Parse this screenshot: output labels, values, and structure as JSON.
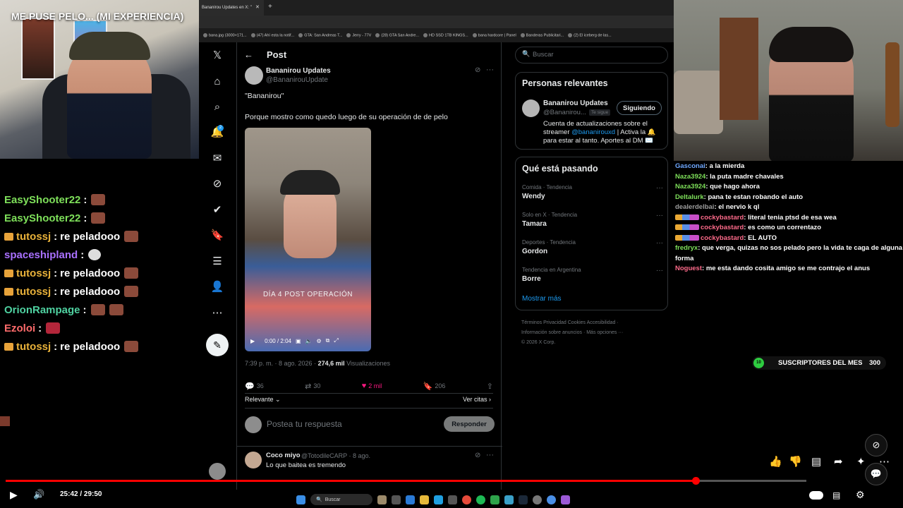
{
  "stream_title": "ME PUSE PELO... (MI EXPERIENCIA)",
  "browser": {
    "active_tab": "Bananirou Updates en X: \"",
    "tab_close": "✕",
    "new_tab": "+",
    "bookmarks": [
      "bana.jpg (3000×171...",
      "(47) Ahí esta la notif...",
      "GTA: San Andreas T...",
      "Jerry - 77V",
      "(28) GTA San Andre...",
      "HD SSD 1TB KINGS...",
      "bana hardcore | Panel",
      "Banderas Publicitari...",
      "(2) El iceberg de las..."
    ]
  },
  "chat_left": [
    {
      "user": "EasyShooter22",
      "color": "#7ee05a",
      "msg": "",
      "badge": false,
      "emote": "brown"
    },
    {
      "user": "EasyShooter22",
      "color": "#7ee05a",
      "msg": "",
      "badge": false,
      "emote": "brown"
    },
    {
      "user": "tutossj",
      "color": "#e8b13a",
      "msg": "re peladooo",
      "badge": true,
      "emote": "brown"
    },
    {
      "user": "spaceshipland",
      "color": "#a970ff",
      "msg": "",
      "badge": false,
      "emote": "white"
    },
    {
      "user": "tutossj",
      "color": "#e8b13a",
      "msg": "re peladooo",
      "badge": true,
      "emote": "brown"
    },
    {
      "user": "tutossj",
      "color": "#e8b13a",
      "msg": "re peladooo",
      "badge": true,
      "emote": "brown"
    },
    {
      "user": "OrionRampage",
      "color": "#4fd2a1",
      "msg": "",
      "badge": false,
      "emote": "double"
    },
    {
      "user": "Ezoloi",
      "color": "#ff6b6b",
      "msg": "",
      "badge": false,
      "emote": "red"
    },
    {
      "user": "tutossj",
      "color": "#e8b13a",
      "msg": "re peladooo",
      "badge": true,
      "emote": "brown"
    }
  ],
  "x": {
    "nav_icons": [
      "x-logo-icon",
      "home-icon",
      "search-icon",
      "notifications-icon",
      "messages-icon",
      "grok-icon",
      "communities-icon",
      "bookmarks-icon",
      "lists-icon",
      "profile-icon",
      "more-icon"
    ],
    "notif_count": "2",
    "header_title": "Post",
    "back": "←",
    "author_name": "Bananirou Updates",
    "author_handle": "@BananirouUpdate",
    "tweet_line1": "\"Bananirou\"",
    "tweet_line2": "Porque mostro como quedo luego de su operación de de pelo",
    "video_overlay": "DÍA 4 POST OPERACIÓN",
    "video_time": "0:00 / 2:04",
    "meta_time": "7:39 p. m. · 8 ago. 2026 · ",
    "meta_views": "274,6 mil",
    "meta_views_label": " Visualizaciones",
    "replies": "36",
    "reposts": "30",
    "likes": "2 mil",
    "bookmarks": "206",
    "sort_label": "Relevante",
    "quotes_label": "Ver citas",
    "reply_placeholder": "Postea tu respuesta",
    "reply_button": "Responder",
    "comment_name": "Coco miyo",
    "comment_handle": "@TotodileCARP · 8 ago.",
    "comment_text": "Lo que baitea es tremendo",
    "search_placeholder": "Buscar",
    "relevant_title": "Personas relevantes",
    "rel_name": "Bananirou Updates",
    "rel_handle": "@Bananirou...",
    "rel_follows_you": "Te sigue",
    "rel_button": "Siguiendo",
    "rel_bio1": "Cuenta de actualizaciones sobre el",
    "rel_bio2_a": "streamer ",
    "rel_bio2_link": "@bananirouxd",
    "rel_bio2_b": " | Activa la 🔔",
    "rel_bio3": "para estar al tanto. Aportes al DM ✉️",
    "trends_title": "Qué está pasando",
    "trends": [
      {
        "context": "Comida · Tendencia",
        "name": "Wendy"
      },
      {
        "context": "Solo en X · Tendencia",
        "name": "Tamara"
      },
      {
        "context": "Deportes · Tendencia",
        "name": "Gordon"
      },
      {
        "context": "Tendencia en Argentina",
        "name": "Borre"
      }
    ],
    "show_more": "Mostrar más",
    "footer1": "Términos     Privacidad     Cookies     Accesibilidad  ·",
    "footer2": "Información sobre anuncios  ·   Más opciones  ···",
    "footer3": "© 2026 X Corp."
  },
  "chat_right": [
    {
      "user": "Gasconai",
      "color": "#6fa8ff",
      "msg": "a la mierda",
      "badges": false
    },
    {
      "user": "Naza3924",
      "color": "#7ee05a",
      "msg": "la puta madre chavales",
      "badges": false
    },
    {
      "user": "Naza3924",
      "color": "#7ee05a",
      "msg": "que hago ahora",
      "badges": false
    },
    {
      "user": "Deltalurk",
      "color": "#7ee05a",
      "msg": "pana te estan robando el auto",
      "badges": false
    },
    {
      "user": "dealerdelbai",
      "color": "#9e9e9e",
      "msg": "el nervio k ql",
      "badges": false
    },
    {
      "user": "cockybastard",
      "color": "#ff6b8b",
      "msg": "literal tenia ptsd de esa wea",
      "badges": true
    },
    {
      "user": "cockybastard",
      "color": "#ff6b8b",
      "msg": "es como un correntazo",
      "badges": true
    },
    {
      "user": "cockybastard",
      "color": "#ff6b8b",
      "msg": "EL AUTO",
      "badges": true
    },
    {
      "user": "fredryx",
      "color": "#7ee05a",
      "msg": "que verga, quizas no sos pelado pero la vida te caga de alguna forma",
      "badges": false
    },
    {
      "user": "Noguest",
      "color": "#ff6b8b",
      "msg": "me esta dando cosita amigo se me contrajo el anus",
      "badges": false
    }
  ],
  "subs": {
    "label": "SUSCRIPTORES DEL MES",
    "count": "300",
    "icon_text": "10"
  },
  "player": {
    "time": "25:42 / 29:50",
    "progress": 0.8615
  },
  "taskbar": {
    "search": "Buscar"
  },
  "colors": {
    "accent": "#1d9bf0",
    "like": "#f91880",
    "progress": "#ff0000"
  }
}
